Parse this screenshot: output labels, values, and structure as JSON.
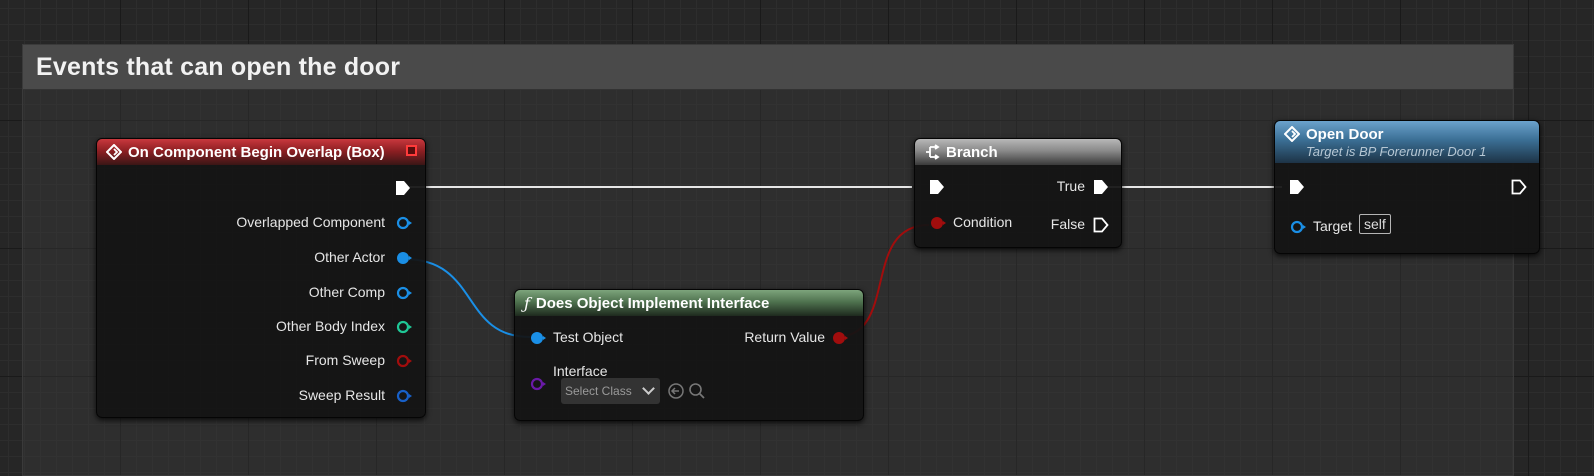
{
  "comment": {
    "title": "Events that can open the door"
  },
  "event_node": {
    "title": "On Component Begin Overlap (Box)",
    "pins": [
      {
        "label": "Overlapped Component",
        "type": "object",
        "color": "#1a8fe6"
      },
      {
        "label": "Other Actor",
        "type": "object",
        "color": "#1a8fe6"
      },
      {
        "label": "Other Comp",
        "type": "object",
        "color": "#1a8fe6"
      },
      {
        "label": "Other Body Index",
        "type": "int",
        "color": "#1fc796"
      },
      {
        "label": "From Sweep",
        "type": "bool",
        "color": "#a10d0d"
      },
      {
        "label": "Sweep Result",
        "type": "struct",
        "color": "#1860c8"
      }
    ]
  },
  "interface_node": {
    "title": "Does Object Implement Interface",
    "test_object_label": "Test Object",
    "return_value_label": "Return Value",
    "interface_label": "Interface",
    "select_class_label": "Select Class"
  },
  "branch_node": {
    "title": "Branch",
    "condition_label": "Condition",
    "true_label": "True",
    "false_label": "False"
  },
  "open_door_node": {
    "title": "Open Door",
    "subtitle": "Target is BP Forerunner Door 1",
    "target_label": "Target",
    "target_value": "self"
  },
  "colors": {
    "event_header": "#8e1f23",
    "function_header": "#4f734f",
    "branch_header": "#8a8a8a",
    "call_header": "#3b6f95",
    "exec_wire": "#e6e6e6",
    "object_wire": "#1a8fe6",
    "bool_wire": "#a10d0d"
  }
}
